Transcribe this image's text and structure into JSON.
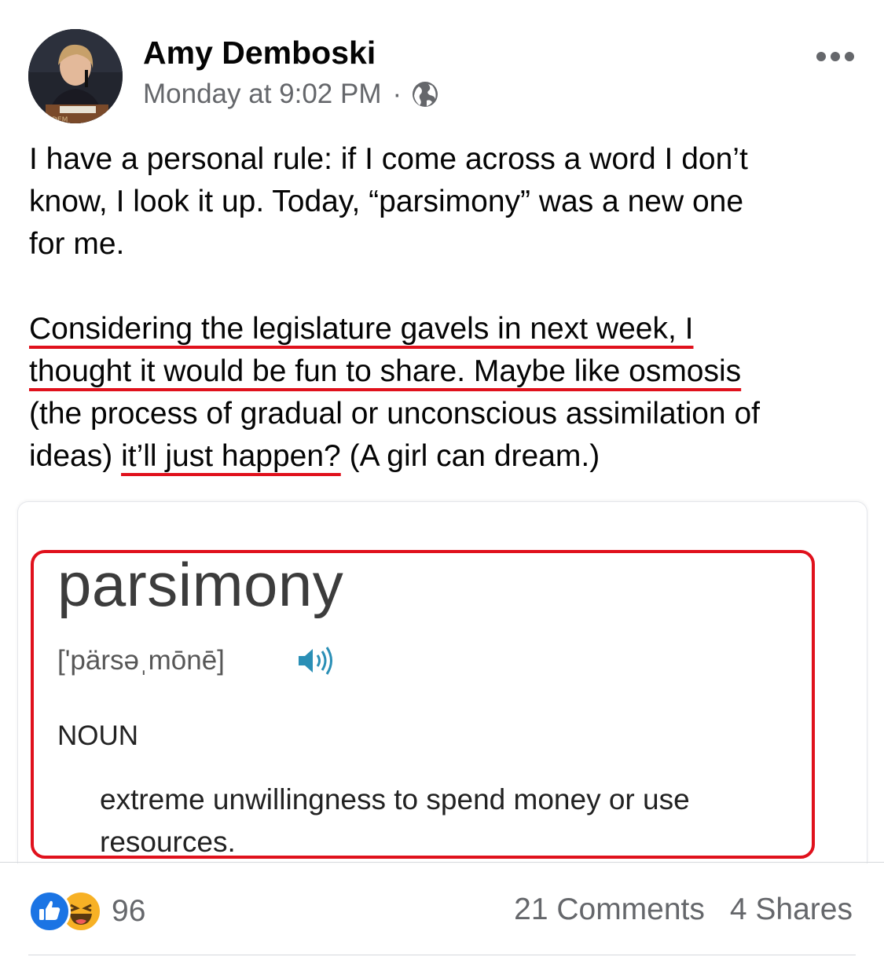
{
  "post": {
    "author": "Amy Demboski",
    "timestamp": "Monday at 9:02 PM",
    "separator": "·",
    "privacy_icon": "globe-icon",
    "more_icon": "more-options-icon",
    "text": {
      "p1_line1": "I have a personal rule: if I come across a word I don’t",
      "p1_line2": "know, I look it up. Today, “parsimony” was a new one",
      "p1_line3": "for me.",
      "p2_line1": "Considering the legislature gavels in next week, I",
      "p2_line2": "thought it would be fun to share. Maybe like osmosis",
      "p2_line3": "(the process of gradual or unconscious assimilation of",
      "p2_line4_before": "ideas) ",
      "p2_line4_underlined": "it’ll just happen?",
      "p2_line4_after": " (A girl can dream.)"
    }
  },
  "dictionary": {
    "word": "parsimony",
    "pronunciation": "['pärsəˌmōnē]",
    "speaker_icon": "speaker-icon",
    "part_of_speech": "NOUN",
    "definition": "extreme unwillingness to spend money or use resources."
  },
  "engagement": {
    "reaction_icons": [
      "like-icon",
      "haha-icon"
    ],
    "reaction_count": "96",
    "comments": "21 Comments",
    "shares": "4 Shares"
  },
  "colors": {
    "annotation_red": "#e0111c",
    "like_blue": "#1b74e4",
    "haha_yellow": "#f7b125",
    "secondary_text": "#65676b",
    "speaker_teal": "#2a8fb6"
  }
}
